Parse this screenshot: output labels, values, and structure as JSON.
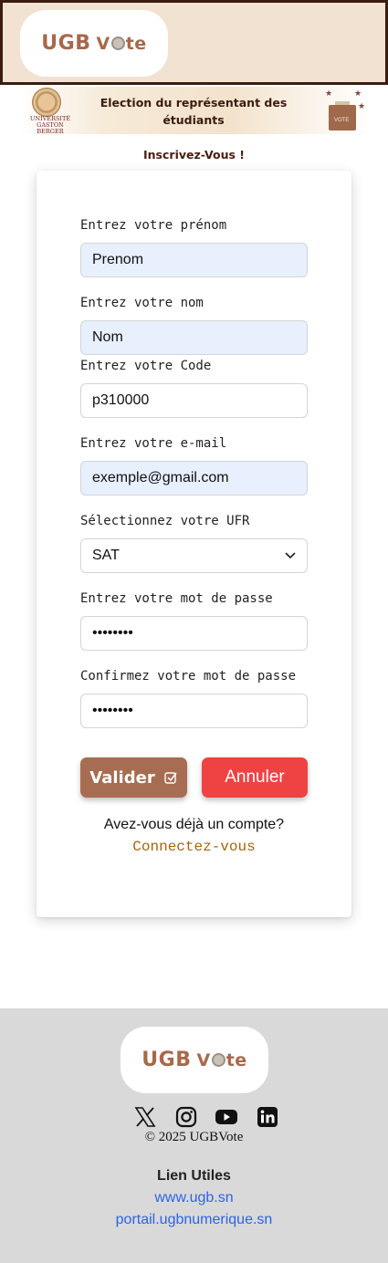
{
  "header": {
    "logo": {
      "brand": "UGB",
      "word_pre": "V",
      "word_post": "te"
    }
  },
  "banner": {
    "university": "UNIVERSITÉ GASTON BERGER",
    "title": "Election du représentant des étudiants",
    "box_label": "VOTE"
  },
  "page": {
    "subtitle": "Inscrivez-Vous !"
  },
  "form": {
    "firstname": {
      "label": "Entrez votre prénom",
      "value": "Prenom"
    },
    "lastname": {
      "label": "Entrez votre nom",
      "value": "Nom"
    },
    "code": {
      "label": "Entrez votre Code",
      "value": "p310000"
    },
    "email": {
      "label": "Entrez votre e-mail",
      "value": "exemple@gmail.com"
    },
    "ufr": {
      "label": "Sélectionnez votre UFR",
      "selected": "SAT"
    },
    "password": {
      "label": "Entrez votre mot de passe",
      "value": "••••••••"
    },
    "confirm": {
      "label": "Confirmez votre mot de passe",
      "value": "••••••••"
    },
    "submit_label": "Valider",
    "cancel_label": "Annuler",
    "have_account": "Avez-vous déjà un compte?",
    "login_link": "Connectez-vous"
  },
  "footer": {
    "logo": {
      "brand": "UGB",
      "word_pre": "V",
      "word_post": "te"
    },
    "socials": [
      "x-icon",
      "instagram-icon",
      "youtube-icon",
      "linkedin-icon"
    ],
    "copyright": "© 2025 UGBVote",
    "links_title": "Lien Utiles",
    "links": [
      "www.ugb.sn",
      "portail.ugbnumerique.sn"
    ]
  },
  "colors": {
    "header_bg": "#f1e2d2",
    "brand": "#a8684a",
    "valider": "#a76d52",
    "annuler": "#ef4343",
    "link": "#2b64e8",
    "login_link": "#a8640b",
    "footer_bg": "#d9d9d9"
  }
}
